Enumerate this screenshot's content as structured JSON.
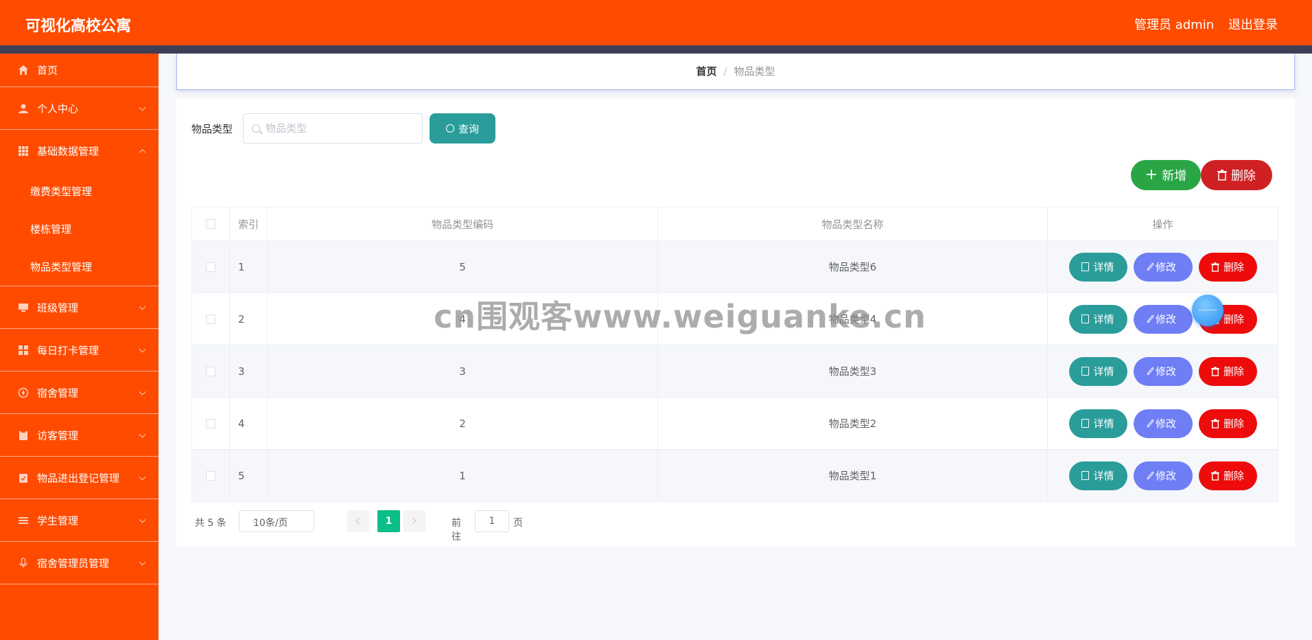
{
  "header": {
    "app_title": "可视化高校公寓",
    "user_label": "管理员 admin",
    "logout_label": "退出登录"
  },
  "sidebar": {
    "items": [
      {
        "label": "首页",
        "icon": "home-icon"
      },
      {
        "label": "个人中心",
        "icon": "user-icon"
      },
      {
        "label": "基础数据管理",
        "icon": "grid-icon",
        "expanded": true,
        "children": [
          {
            "label": "缴费类型管理"
          },
          {
            "label": "楼栋管理"
          },
          {
            "label": "物品类型管理"
          }
        ]
      },
      {
        "label": "班级管理",
        "icon": "monitor-icon"
      },
      {
        "label": "每日打卡管理",
        "icon": "apps-icon"
      },
      {
        "label": "宿舍管理",
        "icon": "compass-icon"
      },
      {
        "label": "访客管理",
        "icon": "clipboard-icon"
      },
      {
        "label": "物品进出登记管理",
        "icon": "checklist-icon"
      },
      {
        "label": "学生管理",
        "icon": "list-icon"
      },
      {
        "label": "宿舍管理员管理",
        "icon": "mic-icon"
      }
    ]
  },
  "breadcrumb": {
    "home": "首页",
    "separator": "/",
    "current": "物品类型"
  },
  "search": {
    "label": "物品类型",
    "placeholder": "物品类型",
    "value": "",
    "query_label": "查询"
  },
  "actions": {
    "add_label": "新增",
    "delete_label": "删除"
  },
  "table": {
    "headers": {
      "index": "索引",
      "code": "物品类型编码",
      "name": "物品类型名称",
      "ops": "操作"
    },
    "rows": [
      {
        "index": "1",
        "code": "5",
        "name": "物品类型6"
      },
      {
        "index": "2",
        "code": "4",
        "name": "物品类型4"
      },
      {
        "index": "3",
        "code": "3",
        "name": "物品类型3"
      },
      {
        "index": "4",
        "code": "2",
        "name": "物品类型2"
      },
      {
        "index": "5",
        "code": "1",
        "name": "物品类型1"
      }
    ],
    "row_actions": {
      "detail": "详情",
      "edit": "修改",
      "delete": "删除"
    }
  },
  "pagination": {
    "total_text": "共 5 条",
    "page_size": "10条/页",
    "current_page": "1",
    "goto_prefix": "前往",
    "goto_value": "1",
    "goto_suffix": "页"
  },
  "watermark": "cn围观客www.weiguanke.cn",
  "colors": {
    "header_bg": "#ff4b00",
    "sidebar_bg": "#ff4b00",
    "dark_strip": "#3d3f55",
    "query_button": "#2a9d9a",
    "add_button": "#2aa545",
    "delete_button": "#cf2024",
    "detail_button": "#2a9d9a",
    "edit_button": "#6f7ef5",
    "row_delete_button": "#ed0b0b",
    "page_active": "#0bbd87"
  }
}
